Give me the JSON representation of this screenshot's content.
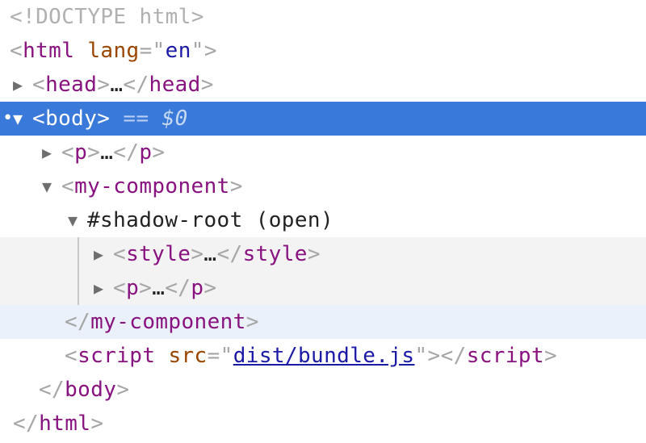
{
  "doctype": "<!DOCTYPE html>",
  "html_open": {
    "lt": "<",
    "tag": "html",
    "attr_name": "lang",
    "eq": "=\"",
    "attr_value": "en",
    "quote_gt": "\">"
  },
  "head_line": {
    "lt": "<",
    "tag": "head",
    "gt": ">",
    "ellipsis": "…",
    "close_lt": "</",
    "close_tag": "head",
    "close_gt": ">"
  },
  "body_line": {
    "lt": "<",
    "tag": "body",
    "gt": ">",
    "eq_marker": "==",
    "ref": "$0"
  },
  "p_line": {
    "lt": "<",
    "tag": "p",
    "gt": ">",
    "ellipsis": "…",
    "close_lt": "</",
    "close_tag": "p",
    "close_gt": ">"
  },
  "component_open": {
    "lt": "<",
    "tag": "my-component",
    "gt": ">"
  },
  "shadow_root": {
    "label": "#shadow-root (open)"
  },
  "style_line": {
    "lt": "<",
    "tag": "style",
    "gt": ">",
    "ellipsis": "…",
    "close_lt": "</",
    "close_tag": "style",
    "close_gt": ">"
  },
  "shadow_p_line": {
    "lt": "<",
    "tag": "p",
    "gt": ">",
    "ellipsis": "…",
    "close_lt": "</",
    "close_tag": "p",
    "close_gt": ">"
  },
  "component_close": {
    "lt": "</",
    "tag": "my-component",
    "gt": ">"
  },
  "script_line": {
    "lt": "<",
    "tag": "script",
    "attr_name": "src",
    "eq": "=\"",
    "attr_value": "dist/bundle.js",
    "quote_gt": "\">",
    "close_lt": "</",
    "close_tag": "script",
    "close_gt": ">"
  },
  "body_close": {
    "lt": "</",
    "tag": "body",
    "gt": ">"
  },
  "html_close": {
    "lt": "</",
    "tag": "html",
    "gt": ">"
  },
  "icons": {
    "expanded": "▼",
    "collapsed": "▶",
    "selection_dot": "•"
  },
  "colors": {
    "selection": "#3879d9",
    "hover": "#eaf1fb",
    "shadow_bg": "#f3f3f3",
    "tag": "#881280",
    "attr_name": "#994500",
    "attr_value": "#1a1aa6"
  }
}
